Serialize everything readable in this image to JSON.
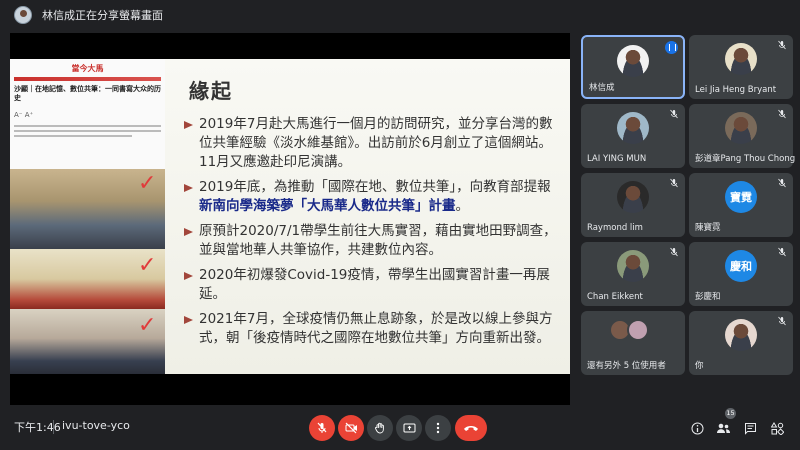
{
  "topbar": {
    "presenting_text": "林信成正在分享螢幕畫面"
  },
  "slide": {
    "title": "緣起",
    "article": {
      "logo": "當今大馬",
      "title": "沙顯｜在地記憶、數位共筆：一同書寫大众的历史",
      "font_size": "A⁻  A⁺"
    },
    "bullets": [
      {
        "parts": [
          {
            "t": "2019年7月赴大馬進行一個月的訪問研究，並分享台灣的數位共筆經驗《淡水維基館》。出訪前於6月創立了這個網站。11月又應邀赴印尼演講。"
          }
        ]
      },
      {
        "parts": [
          {
            "t": "2019年底，為推動「國際在地、數位共筆」，向教育部提報"
          },
          {
            "t": "新南向學海築夢「大馬華人數位共筆」計畫",
            "hl": true
          },
          {
            "t": "。"
          }
        ]
      },
      {
        "parts": [
          {
            "t": "原預計2020/7/1帶學生前往大馬實習，藉由實地田野調查，並與當地華人共筆協作，共建數位內容。"
          }
        ]
      },
      {
        "parts": [
          {
            "t": "2020年初爆發Covid-19疫情，帶學生出國實習計畫一再展延。"
          }
        ]
      },
      {
        "parts": [
          {
            "t": "2021年7月，全球疫情仍無止息跡象，於是改以線上參與方式，朝「後疫情時代之國際在地數位共筆」方向重新出發。"
          }
        ]
      }
    ]
  },
  "participants": [
    {
      "name": "林信成",
      "kind": "photo",
      "color": "#f2f2f2",
      "active": true,
      "mic": "on"
    },
    {
      "name": "Lei Jia Heng Bryant",
      "kind": "photo",
      "color": "#e8e0c8",
      "active": false,
      "mic": "off"
    },
    {
      "name": "LAI YING MUN",
      "kind": "photo",
      "color": "#9fb8c8",
      "active": false,
      "mic": "off"
    },
    {
      "name": "彭道章Pang Thou Chong",
      "kind": "photo",
      "color": "#7a6a5a",
      "active": false,
      "mic": "off"
    },
    {
      "name": "Raymond lim",
      "kind": "photo",
      "color": "#2a2a2a",
      "active": false,
      "mic": "off"
    },
    {
      "name": "陳寶霓",
      "kind": "letter",
      "letter": "寶霓",
      "color": "#1e88e5",
      "active": false,
      "mic": "off"
    },
    {
      "name": "Chan Eikkent",
      "kind": "photo",
      "color": "#8a9a7a",
      "active": false,
      "mic": "off"
    },
    {
      "name": "彭慶和",
      "kind": "letter",
      "letter": "慶和",
      "color": "#1e88e5",
      "active": false,
      "mic": "off"
    },
    {
      "name": "還有另外 5 位使用者",
      "kind": "more",
      "active": false,
      "mic": "none"
    },
    {
      "name": "你",
      "kind": "photo",
      "color": "#e6d8d0",
      "active": false,
      "mic": "off"
    }
  ],
  "bottombar": {
    "time": "下午1:46",
    "meeting_code": "ivu-tove-yco",
    "participant_count": "15"
  }
}
